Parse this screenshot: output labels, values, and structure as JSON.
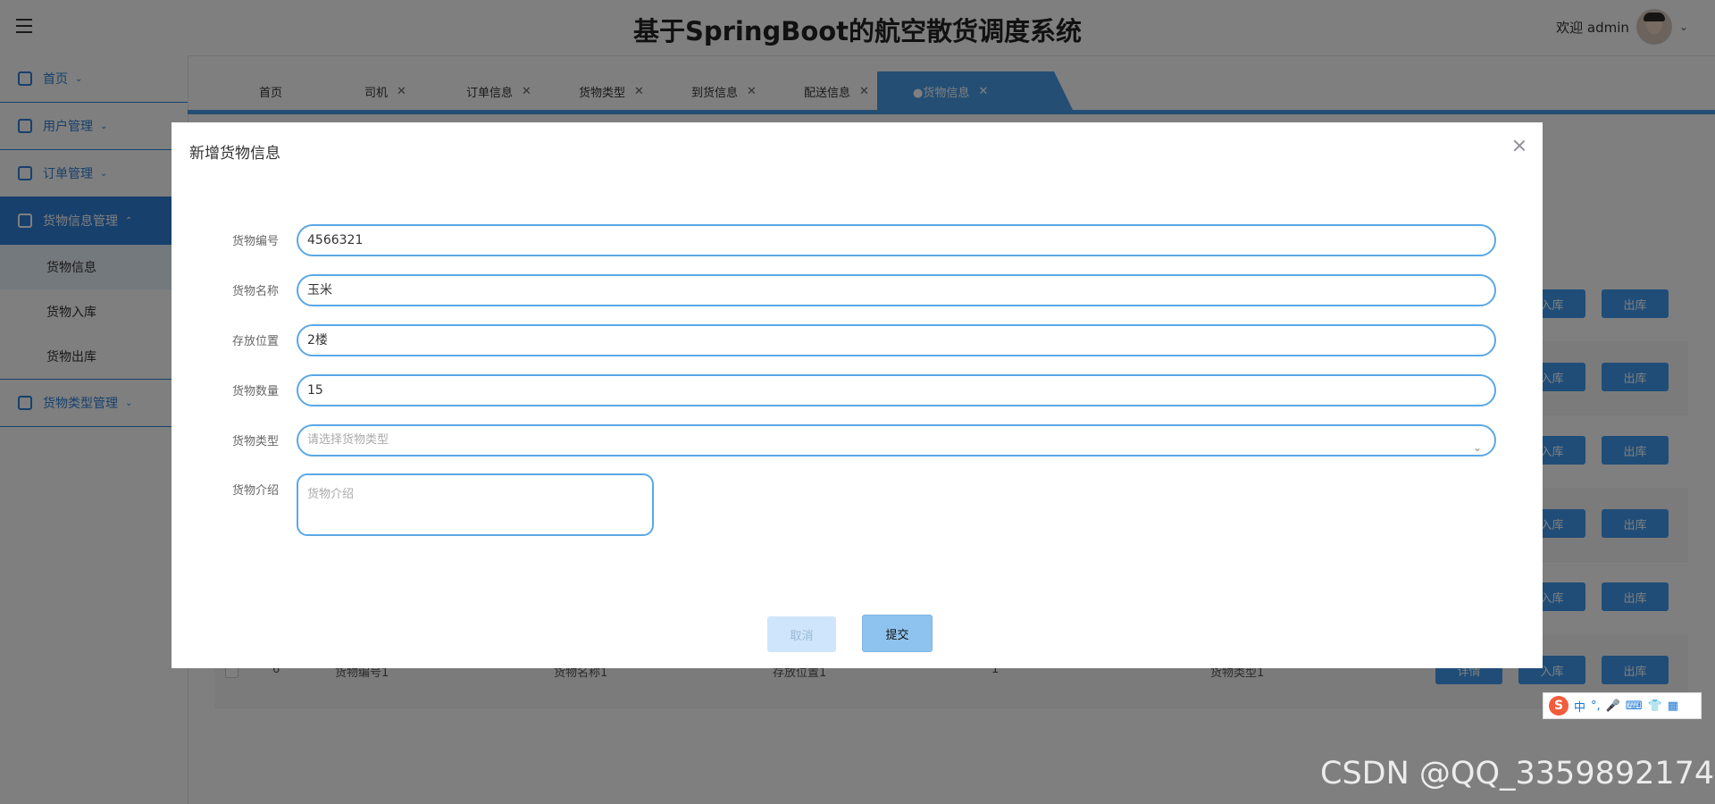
{
  "header": {
    "title": "基于SpringBoot的航空散货调度系统",
    "welcome": "欢迎 admin"
  },
  "sidebar": {
    "items": [
      {
        "label": "首页",
        "icon": "home-icon"
      },
      {
        "label": "用户管理",
        "icon": "user-icon"
      },
      {
        "label": "订单管理",
        "icon": "order-icon"
      },
      {
        "label": "货物信息管理",
        "icon": "cargo-info-icon",
        "active": true
      },
      {
        "label": "货物类型管理",
        "icon": "cargo-type-icon"
      }
    ],
    "sub_items": [
      {
        "label": "货物信息",
        "active": true
      },
      {
        "label": "货物入库"
      },
      {
        "label": "货物出库"
      }
    ]
  },
  "tabs": [
    {
      "label": "首页"
    },
    {
      "label": "司机"
    },
    {
      "label": "订单信息"
    },
    {
      "label": "货物类型"
    },
    {
      "label": "到货信息"
    },
    {
      "label": "配送信息"
    },
    {
      "label": "●货物信息",
      "active": true
    }
  ],
  "table": {
    "visible_rows": [
      {
        "index": "6",
        "code": "货物编号1",
        "name": "货物名称1",
        "location": "存放位置1",
        "qty": "1",
        "type": "货物类型1"
      }
    ],
    "buttons": {
      "detail": "详情",
      "in": "入库",
      "out": "出库"
    }
  },
  "dialog": {
    "title": "新增货物信息",
    "fields": {
      "code": {
        "label": "货物编号",
        "value": "4566321"
      },
      "name": {
        "label": "货物名称",
        "value": "玉米"
      },
      "location": {
        "label": "存放位置",
        "value": "2楼"
      },
      "quantity": {
        "label": "货物数量",
        "value": "15"
      },
      "type": {
        "label": "货物类型",
        "placeholder": "请选择货物类型"
      },
      "intro": {
        "label": "货物介绍",
        "placeholder": "货物介绍"
      }
    },
    "cancel_label": "取消",
    "submit_label": "提交"
  },
  "ime": {
    "label": "中"
  },
  "watermark": "CSDN @QQ_3359892174"
}
